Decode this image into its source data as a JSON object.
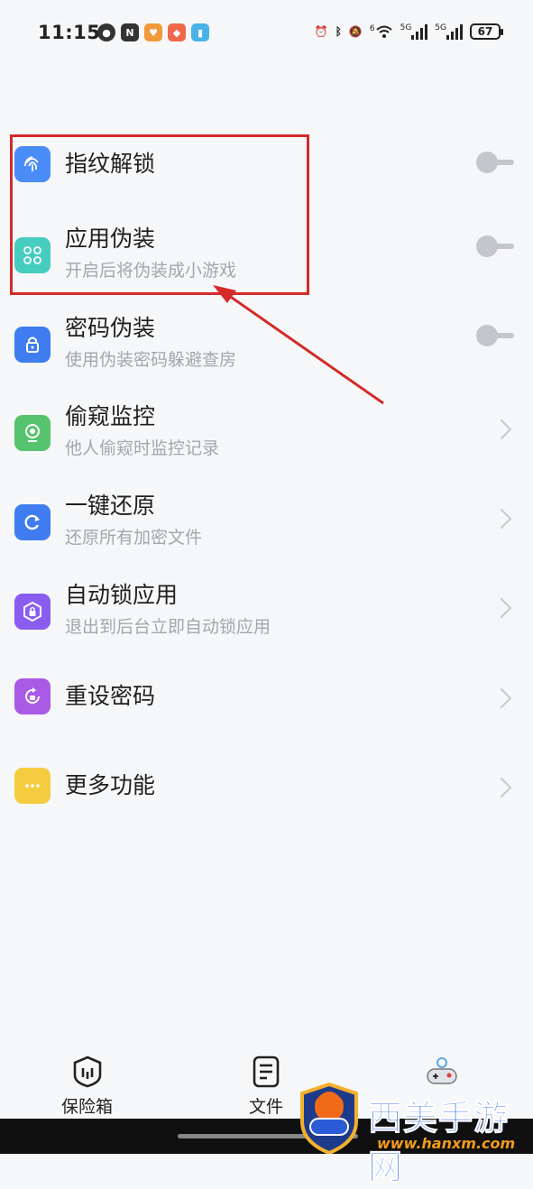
{
  "status_bar": {
    "time": "11:15",
    "battery": "67",
    "signal_1": "5G",
    "signal_2": "5G",
    "wifi_badge": "6"
  },
  "settings": {
    "items": [
      {
        "title": "指纹解锁",
        "subtitle": "",
        "control": "toggle",
        "toggle_on": false,
        "icon": "fingerprint-icon",
        "icon_color": "#4a8cf7"
      },
      {
        "title": "应用伪装",
        "subtitle": "开启后将伪装成小游戏",
        "control": "toggle",
        "toggle_on": false,
        "icon": "apps-grid-icon",
        "icon_color": "#46cdc0"
      },
      {
        "title": "密码伪装",
        "subtitle": "使用伪装密码躲避查房",
        "control": "toggle",
        "toggle_on": false,
        "icon": "lock-icon",
        "icon_color": "#3f7cf0"
      },
      {
        "title": "偷窥监控",
        "subtitle": "他人偷窥时监控记录",
        "control": "chevron",
        "icon": "camera-icon",
        "icon_color": "#56c46e"
      },
      {
        "title": "一键还原",
        "subtitle": "还原所有加密文件",
        "control": "chevron",
        "icon": "restore-icon",
        "icon_color": "#3f7cf0"
      },
      {
        "title": "自动锁应用",
        "subtitle": "退出到后台立即自动锁应用",
        "control": "chevron",
        "icon": "hex-lock-icon",
        "icon_color": "#8a5cf0"
      },
      {
        "title": "重设密码",
        "subtitle": "",
        "control": "chevron",
        "icon": "reset-lock-icon",
        "icon_color": "#a95ae6"
      },
      {
        "title": "更多功能",
        "subtitle": "",
        "control": "chevron",
        "icon": "more-dots-icon",
        "icon_color": "#f5cc3f"
      }
    ]
  },
  "bottom_nav": {
    "items": [
      {
        "label": "保险箱",
        "icon": "vault-icon"
      },
      {
        "label": "文件",
        "icon": "file-icon"
      },
      {
        "label": "",
        "icon": "gamepad-icon"
      }
    ]
  },
  "watermark": {
    "brand": "西美手游网",
    "url": "www.hanxm.com"
  },
  "colors": {
    "highlight": "#d42a2a",
    "arrow": "#d42a2a"
  }
}
